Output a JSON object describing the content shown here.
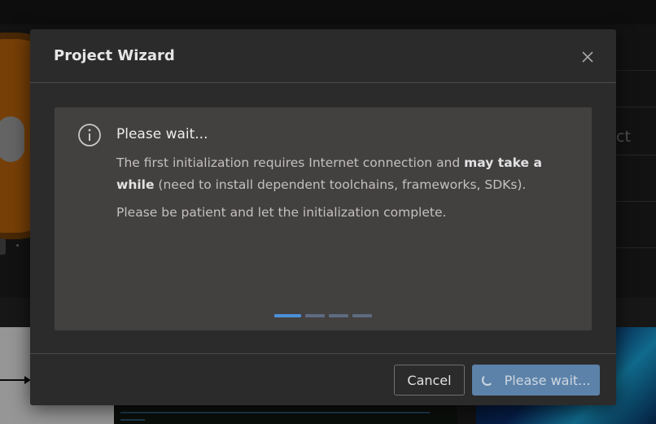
{
  "dialog": {
    "title": "Project Wizard",
    "message": {
      "title": "Please wait...",
      "body_part1": "The first initialization requires Internet connection and ",
      "body_bold": "may take a while",
      "body_part2": " (need to install dependent toolchains, frameworks, SDKs).",
      "note": "Please be patient and let the initialization complete."
    },
    "progress": {
      "segments": 4,
      "active_segment": 1
    },
    "buttons": {
      "cancel_label": "Cancel",
      "primary_label": "Please wait..."
    }
  },
  "background": {
    "right_panel_text": "ct"
  },
  "colors": {
    "dialog_bg": "#2c2b2b",
    "panel_bg": "#434040",
    "accent": "#4a90d9",
    "primary_button": "#5f87b0",
    "progress_inactive": "#5d6b80"
  },
  "icons": {
    "close": "close-icon",
    "info": "info-icon",
    "spinner": "spinner-icon"
  }
}
